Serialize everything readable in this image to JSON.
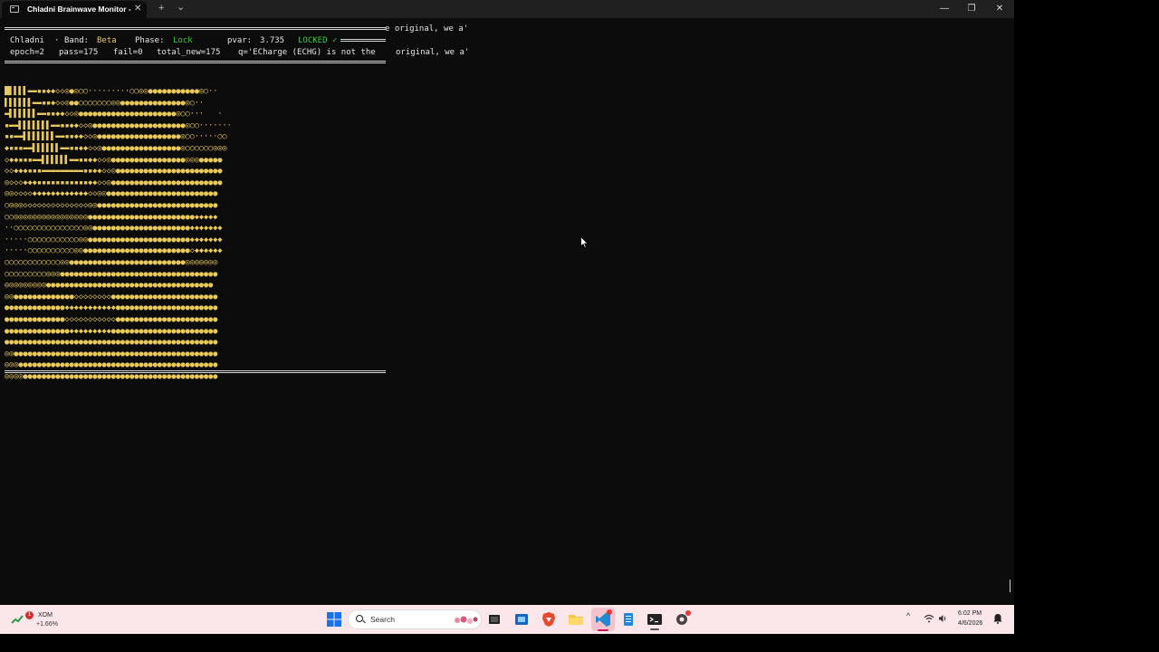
{
  "window": {
    "tab_title": "Chladni Brainwave Monitor -",
    "tab_close": "✕",
    "new_tab": "+",
    "tab_dropdown": "⌄",
    "minimize": "—",
    "maximize": "❐",
    "close": "✕"
  },
  "terminal": {
    "overflow_text_1": "e original, we a'",
    "overflow_text_2": "original, we a'",
    "status": {
      "app": "Chladni",
      "sep": "·",
      "band_label": "Band:",
      "band_value": "Beta",
      "phase_label": "Phase:",
      "phase_value": "Lock",
      "pvar_label": "pvar:",
      "pvar_value": "3.735",
      "locked": "LOCKED ✓"
    },
    "stats": {
      "epoch": "epoch=2",
      "pass": "pass=175",
      "fail": "fail=0",
      "total_new": "total_new=175",
      "query": "q='ECharge (ECHG) is not the"
    },
    "grid_rows": [
      "█▌▌▌▌▬▬▪▪◆◆◇◇◎●◎○○·········○○◎◎●●●●●●●●●●●◎○·· ",
      "▌▌▌▌▌▌▬▬▪▪◆◇◇◎●●○○○○○○○◎◎●●●●●●●●●●●●●●◎○·· ",
      "▬▌▌▌▌▌▌▬▬▪▪◆◆◇◇◎●●●●●●●●●●●●●●●●●●●●●◎○○···   · ",
      "▪▬▬▌▌▌▌▌▌▌▬▬▪▪◆◆◇◇◎●●●●●●●●●●●●●●●●●●●●◎○○·······",
      "▪▪▬▬▌▌▌▌▌▌▌▬▬▪▪◆◆◇◇◎●●●●●●●●●●●●●●●●●●◎○○·····○○",
      "◆▪▪▪▬▬▌▌▌▌▌▌▬▬▪▪◆◆◇◇◎●●●●●●●●●●●●●●●●●◎○○○○○○◎◎◎",
      "◇◆◆▪▪▪▬▬▌▌▌▌▌▌▬▬▪▪◆◆◇◇◎●●●●●●●●●●●●●●●●◎◎◎●●●●●",
      "◇◇◆◆◆▪▪▪▬▬▬▬▬▬▬▬▬▪▪◆◆◇◇◎●●●●●●●●●●●●●●●●●●●●●●●",
      "◎◇◇◇◆◆◆▪▪▪▪▪▪▪▪▪▪▪◆◆◇◇◎●●●●●●●●●●●●●●●●●●●●●●●●",
      "◎◎◇◇◇◇◆◆◆◆◆◆◆◆◆◆◆◆◇◇◎◎●●●●●●●●●●●●●●●●●●●●●●●●",
      "○◎◎◎◇◇◇◇◇◇◇◇◇◇◇◇◇◇◎◎●●●●●●●●●●●●●●●●●●●●●●●●●●",
      "○○◎◎◎◎◎◎◎◎◎◎◎◎◎◎◎◎●●●●●●●●●●●●●●●●●●●●●●●◆◆◆◆◆",
      "··○○○○○○○○○○○○○○○◎◎●●●●●●●●●●●●●●●●●●●●●◆◆◆◆◆◆◆",
      "·····○○○○○○○○○○○◎◎●●●●●●●●●●●●●●●●●●●●●●◆◆◆◆◆◆◆",
      "·····○○○○○○○○○○◎◎●●●●●●●●●●●●●●●●●●●●●●●◇◆◆◆◆◆◆",
      "○○○○○○○○○○○○◎◎●●●●●●●●●●●●●●●●●●●●●●●●●◎◎◎◎◎◎◎",
      "○○○○○○○○○◎◎◎●●●●●●●●●●●●●●●●●●●●●●●●●●●●●●●●●●",
      "◎◎◎◎◎◎◎◎◎●●●●●●●●●●●●●●●●●●●●●●●●●●●●●●●●●●●●",
      "◎◎●●●●●●●●●●●●●◇◇◇◇◇◇◇◇●●●●●●●●●●●●●●●●●●●●●●●",
      "●●●●●●●●●●●●●◆◆◆◆◆◆◆◆◆◆◆●●●●●●●●●●●●●●●●●●●●●●",
      "●●●●●●●●●●●●●◇◇◇◇◇◇◇◇◇◇◇●●●●●●●●●●●●●●●●●●●●●●",
      "●●●●●●●●●●●●●●◆◆◆◆◆◆◆◆◆●●●●●●●●●●●●●●●●●●●●●●●",
      "●●●●●●●●●●●●●●●●●●●●●●●●●●●●●●●●●●●●●●●●●●●●●●",
      "◎◎●●●●●●●●●●●●●●●●●●●●●●●●●●●●●●●●●●●●●●●●●●●●",
      "◎◎◎●●●●●●●●●●●●●●●●●●●●●●●●●●●●●●●●●●●●●●●●●●●",
      "◎◎◎◎●●●●●●●●●●●●●●●●●●●●●●●●●●●●●●●●●●●●●●●●●●"
    ]
  },
  "taskbar": {
    "stock_name": "XOM",
    "stock_change": "+1.66%",
    "stock_badge": "1",
    "search_label": "Search",
    "clock_time": "6:02 PM",
    "clock_date": "4/6/2026",
    "tray_chevron": "^"
  },
  "colors": {
    "terminal_bg": "#0c0c0c",
    "grid_gold": "#e8c95a",
    "locked_green": "#3ec83e",
    "taskbar_bg": "#fbe7ea"
  }
}
